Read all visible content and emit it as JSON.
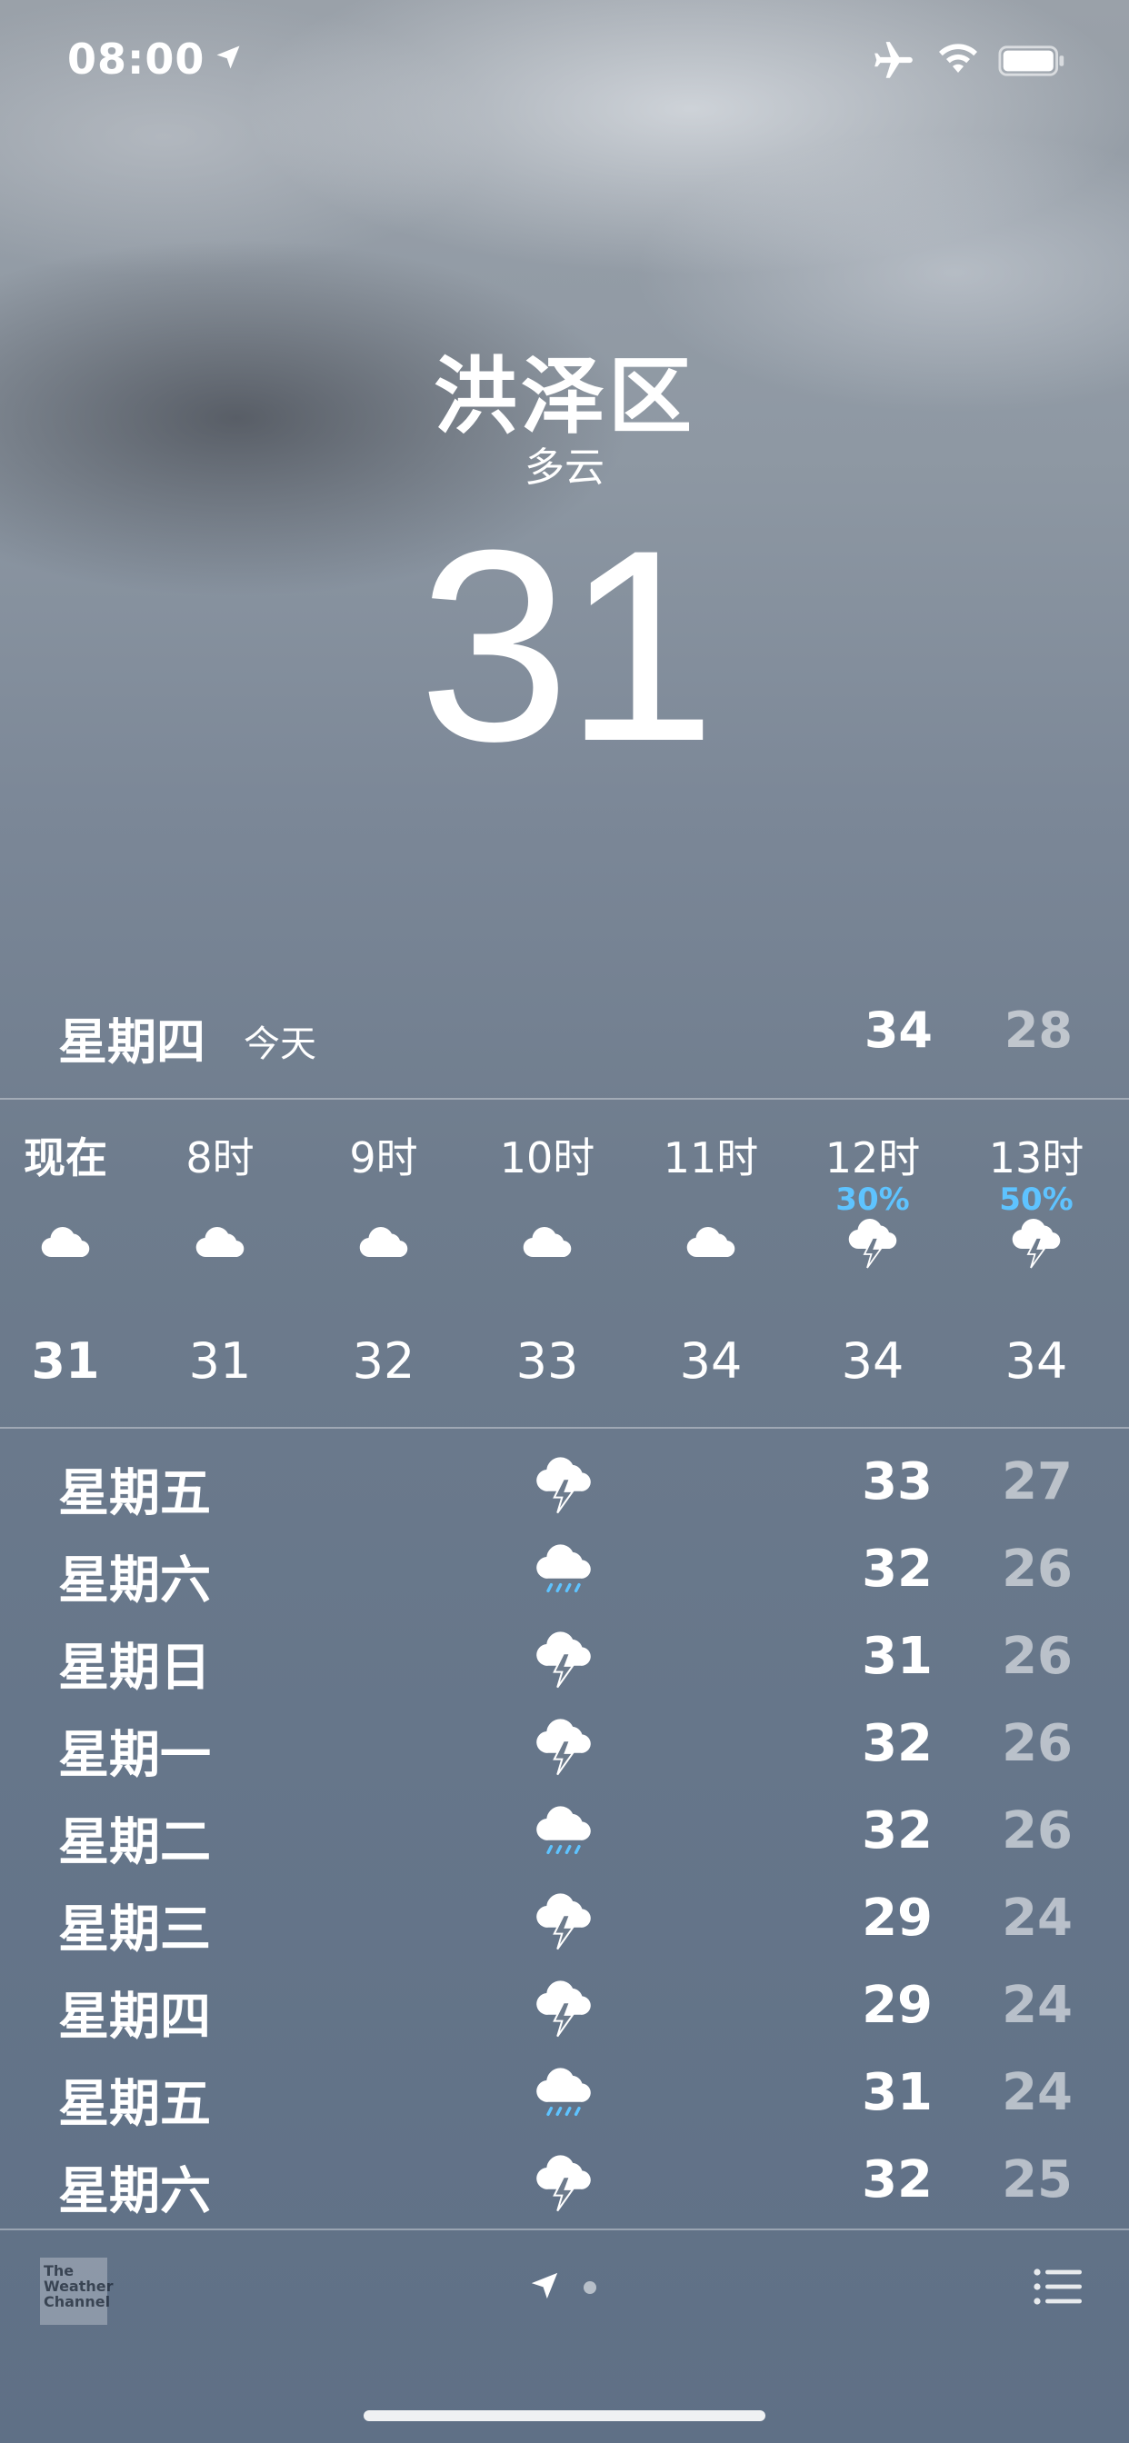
{
  "status_bar": {
    "time": "08:00",
    "icons": [
      "location-arrow-icon",
      "airplane-icon",
      "wifi-icon",
      "battery-icon"
    ]
  },
  "location": {
    "city": "洪泽区",
    "condition": "多云",
    "temperature": "31"
  },
  "today": {
    "day": "星期四",
    "label": "今天",
    "high": "34",
    "low": "28"
  },
  "hourly": [
    {
      "time": "现在",
      "precip": "",
      "icon": "cloud-icon",
      "temp": "31"
    },
    {
      "time": "8时",
      "precip": "",
      "icon": "cloud-icon",
      "temp": "31"
    },
    {
      "time": "9时",
      "precip": "",
      "icon": "cloud-icon",
      "temp": "32"
    },
    {
      "time": "10时",
      "precip": "",
      "icon": "cloud-icon",
      "temp": "33"
    },
    {
      "time": "11时",
      "precip": "",
      "icon": "cloud-icon",
      "temp": "34"
    },
    {
      "time": "12时",
      "precip": "30%",
      "icon": "thunderstorm-icon",
      "temp": "34"
    },
    {
      "time": "13时",
      "precip": "50%",
      "icon": "thunderstorm-icon",
      "temp": "34"
    }
  ],
  "daily": [
    {
      "day": "星期五",
      "icon": "thunderstorm-icon",
      "high": "33",
      "low": "27"
    },
    {
      "day": "星期六",
      "icon": "rain-icon",
      "high": "32",
      "low": "26"
    },
    {
      "day": "星期日",
      "icon": "thunderstorm-icon",
      "high": "31",
      "low": "26"
    },
    {
      "day": "星期一",
      "icon": "thunderstorm-icon",
      "high": "32",
      "low": "26"
    },
    {
      "day": "星期二",
      "icon": "rain-icon",
      "high": "32",
      "low": "26"
    },
    {
      "day": "星期三",
      "icon": "thunderstorm-icon",
      "high": "29",
      "low": "24"
    },
    {
      "day": "星期四",
      "icon": "thunderstorm-icon",
      "high": "29",
      "low": "24"
    },
    {
      "day": "星期五",
      "icon": "rain-icon",
      "high": "31",
      "low": "24"
    },
    {
      "day": "星期六",
      "icon": "thunderstorm-icon",
      "high": "32",
      "low": "25"
    }
  ],
  "footer": {
    "logo_text": [
      "The",
      "Weather",
      "Channel"
    ],
    "icons": [
      "location-arrow-icon",
      "page-dot",
      "list-icon"
    ]
  },
  "colors": {
    "precip_accent": "#5ec3ff",
    "low_temp": "rgba(255,255,255,0.55)",
    "rain_drops": "#5ec3ff"
  }
}
